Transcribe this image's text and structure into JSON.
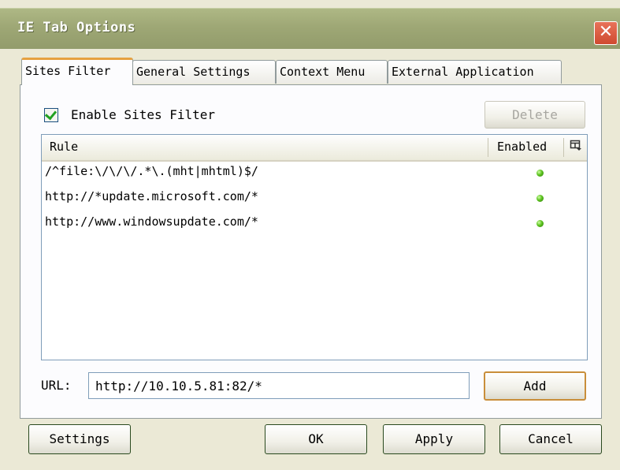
{
  "window": {
    "title": "IE Tab Options",
    "close_label": "✕"
  },
  "tabs": [
    {
      "label": "Sites Filter"
    },
    {
      "label": "General Settings"
    },
    {
      "label": "Context Menu"
    },
    {
      "label": "External Application"
    }
  ],
  "sites_filter": {
    "enable_label": "Enable Sites Filter",
    "enabled_checked": true,
    "delete_label": "Delete",
    "columns": {
      "rule": "Rule",
      "enabled": "Enabled",
      "chooser_icon": "column-chooser-icon"
    },
    "rows": [
      {
        "rule": "/^file:\\/\\/\\/.*\\.(mht|mhtml)$/",
        "enabled": true
      },
      {
        "rule": "http://*update.microsoft.com/*",
        "enabled": true
      },
      {
        "rule": "http://www.windowsupdate.com/*",
        "enabled": true
      }
    ],
    "url_label": "URL:",
    "url_value": "http://10.10.5.81:82/*",
    "add_label": "Add"
  },
  "footer": {
    "settings_label": "Settings",
    "ok_label": "OK",
    "apply_label": "Apply",
    "cancel_label": "Cancel"
  },
  "colors": {
    "title_bar": "#9ea775",
    "active_tab_accent": "#e6a141",
    "enabled_dot": "#5cc21f",
    "close_button": "#cf4a30"
  }
}
